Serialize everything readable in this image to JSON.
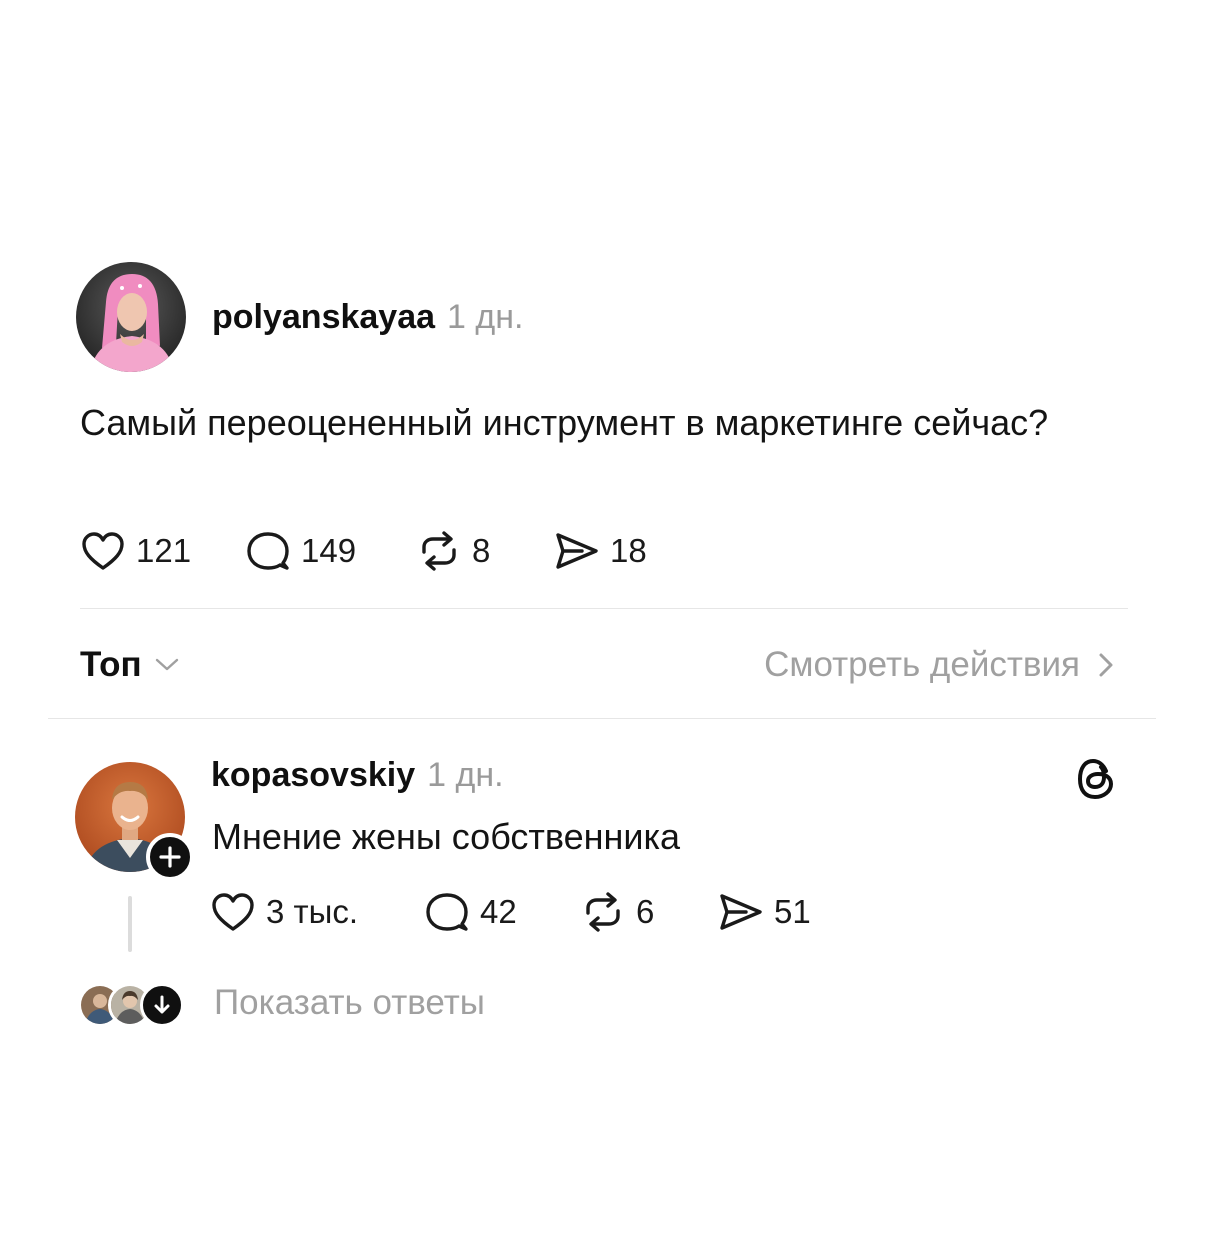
{
  "colors": {
    "text": "#101010",
    "muted": "#9a9a9a",
    "divider": "#e6e6e6",
    "background": "#ffffff"
  },
  "post": {
    "avatar_icon": "profile-photo-woman-pink-hair",
    "username": "polyanskayaa",
    "time": "1 дн.",
    "text": "Самый переоцененный инструмент в маркетинге сейчас?",
    "likes": "121",
    "comments": "149",
    "reposts": "8",
    "shares": "18"
  },
  "sort_bar": {
    "sort_label": "Топ",
    "activity_link": "Смотреть действия"
  },
  "reply": {
    "avatar_icon": "profile-photo-man-orange-background",
    "username": "kopasovskiy",
    "time": "1 дн.",
    "text": "Мнение жены собственника",
    "likes": "3 тыс.",
    "comments": "42",
    "reposts": "6",
    "shares": "51"
  },
  "show_replies": {
    "label": "Показать ответы"
  }
}
